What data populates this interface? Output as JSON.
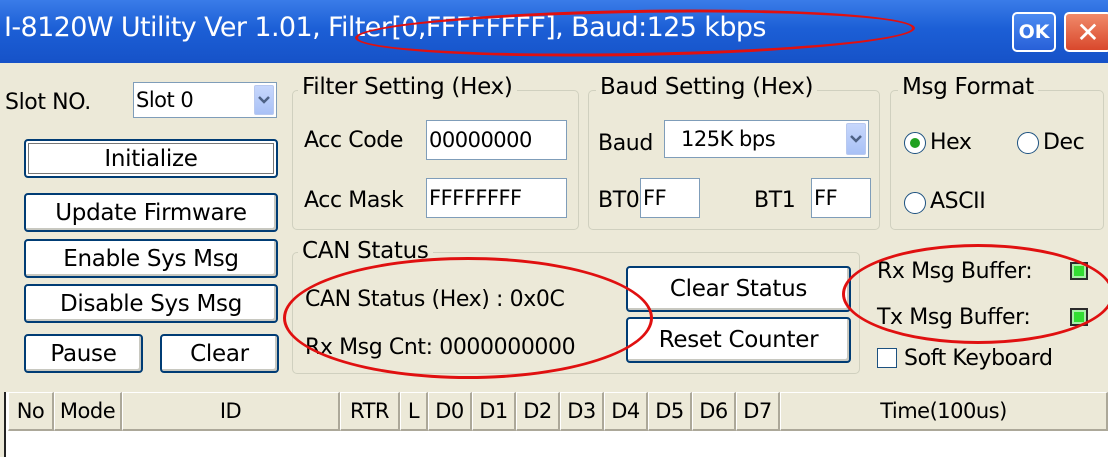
{
  "window": {
    "title": "I-8120W Utility Ver  1.01, Filter[0,FFFFFFFF], Baud:125 kbps",
    "ok_label": "OK",
    "close_symbol": "✕"
  },
  "slot": {
    "label": "Slot NO.",
    "selected": "Slot 0"
  },
  "buttons": {
    "initialize": "Initialize",
    "update_firmware": "Update Firmware",
    "enable_sys_msg": "Enable Sys Msg",
    "disable_sys_msg": "Disable Sys Msg",
    "pause": "Pause",
    "clear": "Clear",
    "clear_status": "Clear Status",
    "reset_counter": "Reset Counter"
  },
  "filter_setting": {
    "title": "Filter Setting (Hex)",
    "acc_code_label": "Acc Code",
    "acc_code_value": "00000000",
    "acc_mask_label": "Acc Mask",
    "acc_mask_value": "FFFFFFFF"
  },
  "baud_setting": {
    "title": "Baud Setting (Hex)",
    "baud_label": "Baud",
    "baud_selected": "125K bps",
    "bt0_label": "BT0",
    "bt0_value": "FF",
    "bt1_label": "BT1",
    "bt1_value": "FF"
  },
  "msg_format": {
    "title": "Msg Format",
    "options": [
      "Hex",
      "Dec",
      "ASCII"
    ],
    "selected": "Hex"
  },
  "can_status": {
    "title": "CAN Status",
    "status_text": "CAN Status (Hex) :  0x0C",
    "rx_count_text": "Rx Msg Cnt: 0000000000"
  },
  "buffers": {
    "rx_label": "Rx Msg Buffer:",
    "tx_label": "Tx Msg Buffer:",
    "indicator_color": "#33dd33"
  },
  "soft_keyboard": {
    "label": "Soft Keyboard",
    "checked": false
  },
  "table": {
    "columns": [
      "No",
      "Mode",
      "ID",
      "RTR",
      "L",
      "D0",
      "D1",
      "D2",
      "D3",
      "D4",
      "D5",
      "D6",
      "D7",
      "Time(100us)"
    ]
  },
  "highlight_color": "#e01010"
}
